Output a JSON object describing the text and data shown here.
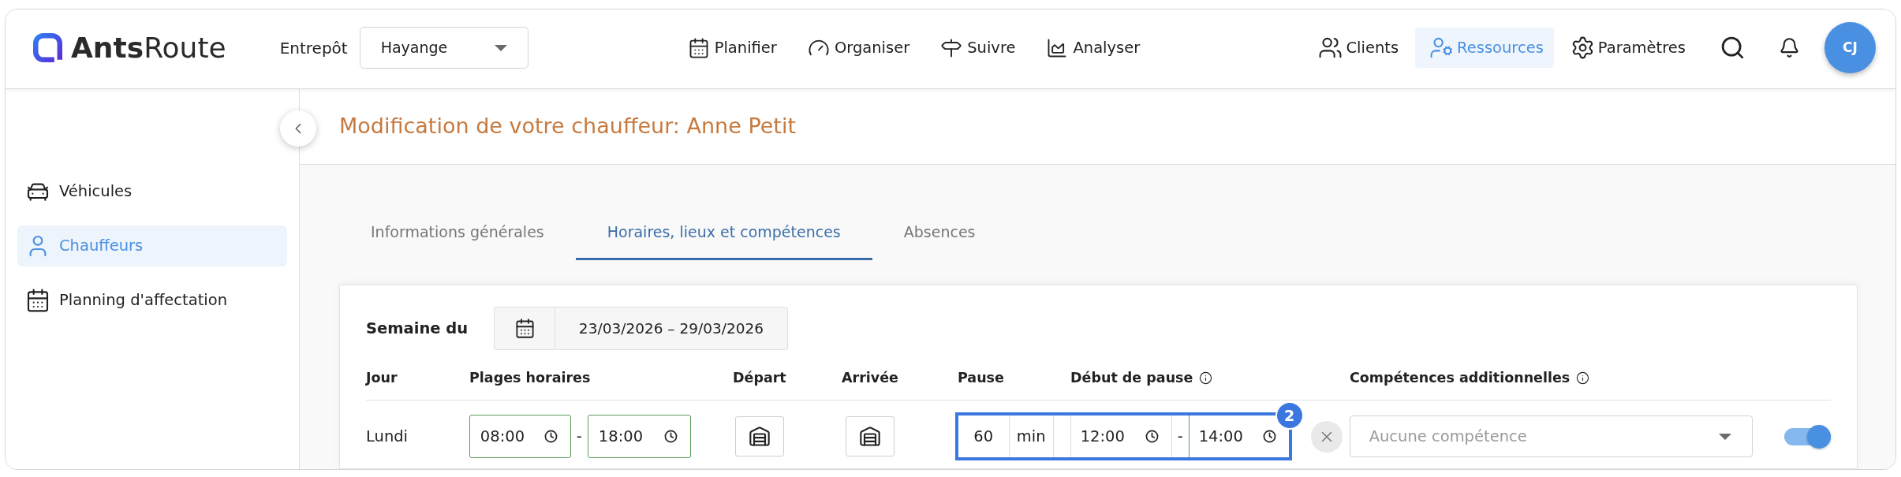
{
  "header": {
    "logo": "**Ants**Route",
    "warehouse": {
      "label": "Entrepôt",
      "value": "Hayange"
    },
    "nav": [
      {
        "label": "Planifier",
        "selected": false
      },
      {
        "label": "Organiser",
        "selected": false
      },
      {
        "label": "Suivre",
        "selected": false
      },
      {
        "label": "Analyser",
        "selected": false
      }
    ],
    "menu": [
      {
        "label": "Clients",
        "selected": false
      },
      {
        "label": "Ressources",
        "selected": true
      },
      {
        "label": "Paramètres",
        "selected": false
      }
    ],
    "user": {
      "initials": "CJ"
    }
  },
  "sidebar": {
    "items": [
      {
        "label": "Véhicules",
        "selected": false
      },
      {
        "label": "Chauffeurs",
        "selected": true
      },
      {
        "label": "Planning d'affectation",
        "selected": false
      }
    ]
  },
  "page": {
    "title": "Modification de votre chauffeur: Anne Petit"
  },
  "tabs": [
    {
      "label": "Informations générales",
      "selected": false
    },
    {
      "label": "Horaires, lieux et compétences",
      "selected": true
    },
    {
      "label": "Absences",
      "selected": false
    }
  ],
  "schedule": {
    "week": {
      "label": "Semaine du",
      "range": "23/03/2026 – 29/03/2026"
    },
    "columns": [
      {
        "label": "Jour",
        "info": false
      },
      {
        "label": "Plages horaires",
        "info": false
      },
      {
        "label": "Départ",
        "info": false
      },
      {
        "label": "Arrivée",
        "info": false
      },
      {
        "label": "Pause",
        "info": false
      },
      {
        "label": "Début de pause",
        "info": true
      },
      {
        "label": "Compétences additionnelles",
        "info": true
      }
    ],
    "rows": [
      {
        "day": "Lundi",
        "hours": [
          {
            "value": "08:00",
            "valid": true
          },
          {
            "value": "18:00",
            "valid": true
          }
        ],
        "hours_separator": "-",
        "pause": {
          "value": "60",
          "unit": "min"
        },
        "pause_window": [
          {
            "value": "12:00",
            "valid": false
          },
          {
            "value": "14:00",
            "valid": true
          }
        ],
        "pause_window_separator": "-",
        "skills": {
          "placeholder": "Aucune compétence"
        },
        "enabled": true
      }
    ]
  },
  "callout": {
    "badge": "2"
  }
}
